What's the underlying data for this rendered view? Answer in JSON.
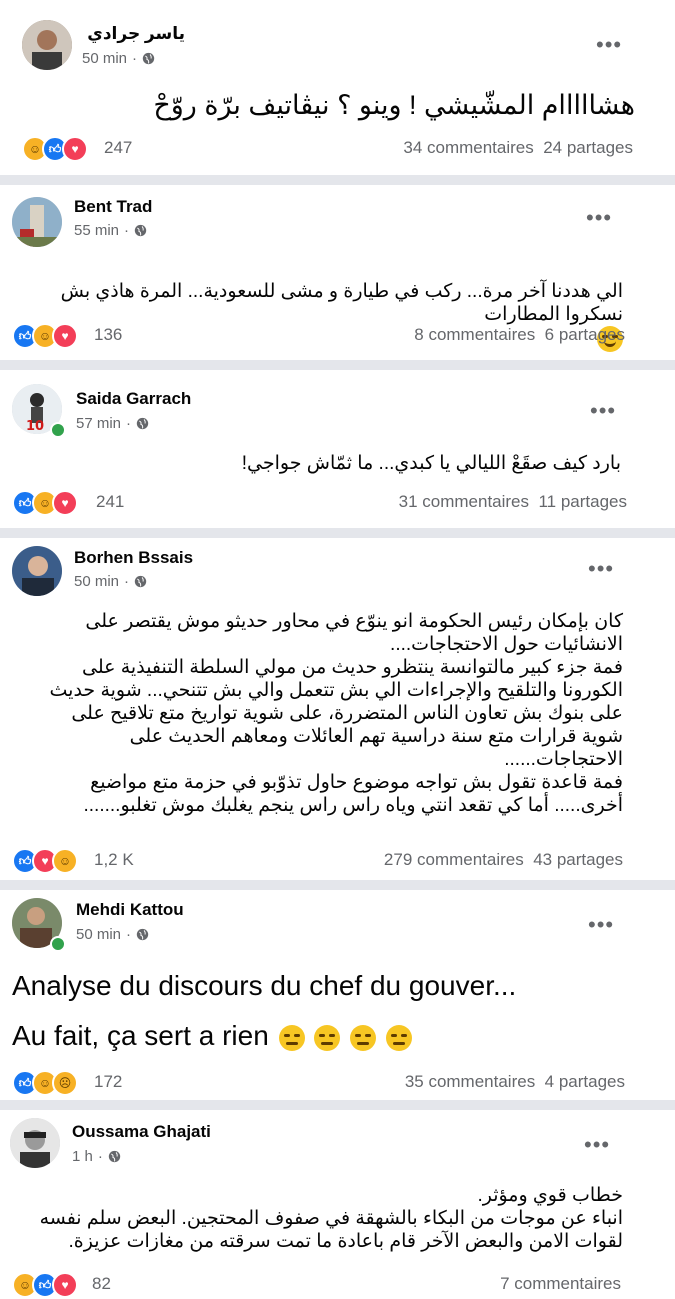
{
  "posts": [
    {
      "author": "ياسر جرادي",
      "time": "50 min",
      "text": "هشااااام المشّيشي ! وينو ؟ نيڤاتيف برّة روّحْ",
      "reactions": [
        "haha",
        "like",
        "love"
      ],
      "reaction_count": "247",
      "comments": "34 commentaires",
      "shares": "24 partages"
    },
    {
      "author": "Bent Trad",
      "time": "55 min",
      "text": "الي هددنا آخر مرة... ركب في طيارة و مشى للسعودية... المرة هاذي بش\nنسكروا المطارات",
      "reactions": [
        "like",
        "haha",
        "love"
      ],
      "reaction_count": "136",
      "comments": "8 commentaires",
      "shares": "6 partages"
    },
    {
      "author": "Saida Garrach",
      "time": "57 min",
      "text": "بارد كيف صقَعْ الليالي يا كبدي... ما  ثمّاش جواجي!",
      "reactions": [
        "like",
        "haha",
        "love"
      ],
      "reaction_count": "241",
      "comments": "31 commentaires",
      "shares": "11 partages"
    },
    {
      "author": "Borhen Bssais",
      "time": "50 min",
      "text": "كان بإمكان رئيس الحكومة انو ينوّع في محاور حديثو موش يقتصر على\nالانشائيات حول الاحتجاجات....\nفمة جزء كبير مالتوانسة ينتظرو حديث من مولي السلطة التنفيذية على\nالكورونا والتلقيح والإجراءات الي بش تتعمل والي بش تتنحي... شوية حديث\nعلى بنوك بش تعاون الناس المتضررة، على شوية تواريخ متع تلاقيح على\nشوية قرارات متع سنة دراسية تهم العائلات ومعاهم الحديث على\nالاحتجاجات......\nفمة قاعدة تقول بش تواجه موضوع حاول تذوّبو في حزمة متع مواضيع\nأخرى..... أما كي تقعد انتي وياه راس راس ينجم يغلبك موش تغلبو.......",
      "reactions": [
        "like",
        "love",
        "haha"
      ],
      "reaction_count": "1,2 K",
      "comments": "279 commentaires",
      "shares": "43 partages"
    },
    {
      "author": "Mehdi Kattou",
      "time": "50 min",
      "text_line1": "Analyse du discours du chef du gouver...",
      "text_line2": "Au fait, ça sert a rien",
      "reactions": [
        "like",
        "haha",
        "sad"
      ],
      "reaction_count": "172",
      "comments": "35 commentaires",
      "shares": "4 partages"
    },
    {
      "author": "Oussama Ghajati",
      "time": "1 h",
      "text": "خطاب قوي ومؤثر.\nانباء عن موجات من البكاء بالشهقة في صفوف المحتجين. البعض سلم نفسه\nلقوات الامن والبعض الآخر قام باعادة ما تمت سرقته من مغازات عزيزة.",
      "reactions": [
        "haha",
        "like",
        "love"
      ],
      "reaction_count": "82",
      "comments": "7 commentaires"
    }
  ],
  "more_label": "•••",
  "icons": {
    "globe": "globe-icon",
    "more": "more-options-icon"
  },
  "colors": {
    "like": "#1877f2",
    "love": "#f33e58",
    "haha": "#f7b125",
    "online": "#31a24c",
    "separator": "#e4e6eb"
  }
}
